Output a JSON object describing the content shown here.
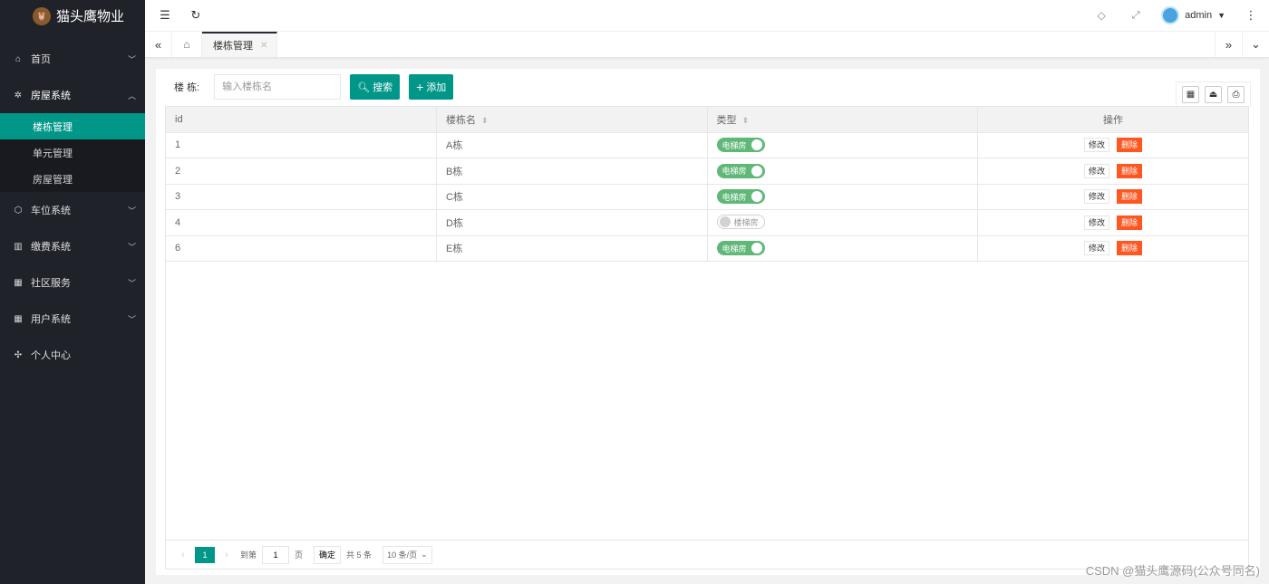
{
  "app": {
    "title": "猫头鹰物业"
  },
  "sidebar": {
    "items": [
      {
        "label": "首页",
        "icon": "home-icon",
        "glyph": "⌂",
        "expanded": false,
        "has_chevron": true
      },
      {
        "label": "房屋系统",
        "icon": "gear-icon",
        "glyph": "✲",
        "expanded": true,
        "has_chevron": true,
        "children": [
          {
            "label": "楼栋管理",
            "active": true
          },
          {
            "label": "单元管理",
            "active": false
          },
          {
            "label": "房屋管理",
            "active": false
          }
        ]
      },
      {
        "label": "车位系统",
        "icon": "cube-icon",
        "glyph": "⬡",
        "expanded": false,
        "has_chevron": true
      },
      {
        "label": "缴费系统",
        "icon": "columns-icon",
        "glyph": "▥",
        "expanded": false,
        "has_chevron": true
      },
      {
        "label": "社区服务",
        "icon": "apps-icon",
        "glyph": "▦",
        "expanded": false,
        "has_chevron": true
      },
      {
        "label": "用户系统",
        "icon": "apps-icon",
        "glyph": "▦",
        "expanded": false,
        "has_chevron": true
      },
      {
        "label": "个人中心",
        "icon": "chip-icon",
        "glyph": "✣",
        "expanded": false,
        "has_chevron": false
      }
    ]
  },
  "header": {
    "user": "admin"
  },
  "tabs": [
    {
      "label": "楼栋管理",
      "active": true
    }
  ],
  "search": {
    "label": "楼 栋:",
    "placeholder": "输入楼栋名",
    "search_button": "搜索",
    "add_button": "添加"
  },
  "table": {
    "columns": [
      {
        "label": "id",
        "sortable": false
      },
      {
        "label": "楼栋名",
        "sortable": true
      },
      {
        "label": "类型",
        "sortable": true
      },
      {
        "label": "操作",
        "sortable": false
      }
    ],
    "rows": [
      {
        "id": "1",
        "name": "A栋",
        "type": "电梯房",
        "on": true
      },
      {
        "id": "2",
        "name": "B栋",
        "type": "电梯房",
        "on": true
      },
      {
        "id": "3",
        "name": "C栋",
        "type": "电梯房",
        "on": true
      },
      {
        "id": "4",
        "name": "D栋",
        "type": "楼梯房",
        "on": false
      },
      {
        "id": "6",
        "name": "E栋",
        "type": "电梯房",
        "on": true
      }
    ],
    "edit_label": "修改",
    "delete_label": "删除"
  },
  "pager": {
    "current": "1",
    "goto_label": "到第",
    "goto_value": "1",
    "page_unit": "页",
    "confirm": "确定",
    "total": "共 5 条",
    "page_size": "10 条/页"
  },
  "watermark": "CSDN @猫头鹰源码(公众号同名)",
  "colors": {
    "primary": "#009688",
    "sidebar": "#20222a",
    "switch_on": "#5fb878",
    "danger": "#ff5722"
  }
}
